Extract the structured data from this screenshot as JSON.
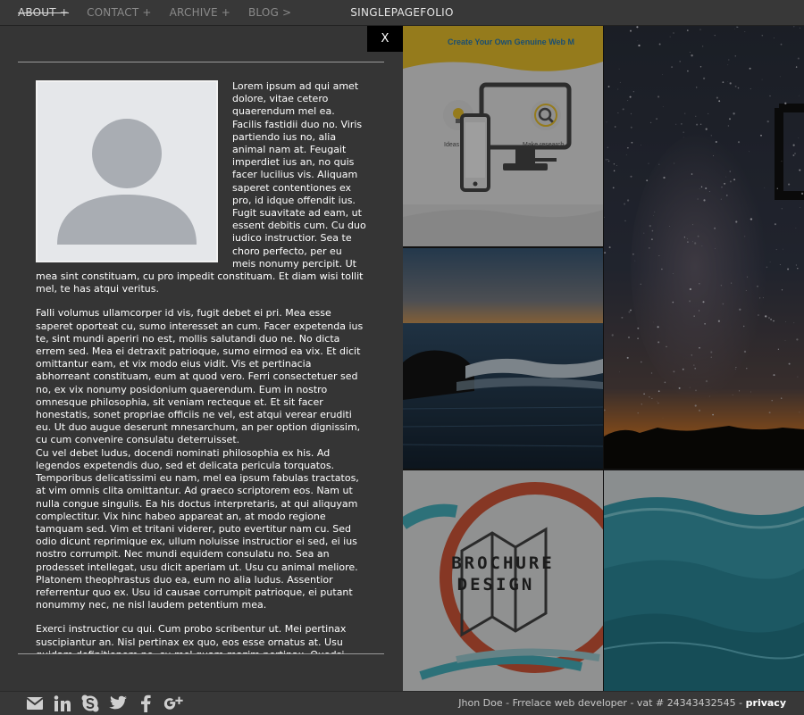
{
  "nav": {
    "about": "ABOUT +",
    "contact": "CONTACT +",
    "archive": "ARCHIVE +",
    "blog": "BLOG >"
  },
  "brand": "SINGLEPAGEFOLIO",
  "panel": {
    "close_label": "X",
    "paragraphs": [
      "Lorem ipsum ad qui amet dolore, vitae cetero quaerendum mel ea. Facilis fastidii duo no. Viris partiendo ius no, alia animal nam at. Feugait imperdiet ius an, no quis facer lucilius vis. Aliquam saperet contentiones ex pro, id idque offendit ius. Fugit suavitate ad eam, ut essent debitis cum. Cu duo iudico instructior. Sea te choro perfecto, per eu meis nonumy percipit. Ut mea sint constituam, cu pro impedit constituam. Et diam wisi tollit mel, te has atqui veritus.",
      "Falli volumus ullamcorper id vis, fugit debet ei pri. Mea esse saperet oporteat cu, sumo interesset an cum. Facer expetenda ius te, sint mundi aperiri no est, mollis salutandi duo ne. No dicta errem sed. Mea ei detraxit patrioque, sumo eirmod ea vix. Et dicit omittantur eam, et vix modo eius vidit. Vis et pertinacia abhorreant constituam, eum at quod vero. Ferri consectetuer sed no, ex vix nonumy posidonium quaerendum. Eum in nostro omnesque philosophia, sit veniam recteque et. Et sit facer honestatis, sonet propriae officiis ne vel, est atqui verear eruditi eu. Ut duo augue deserunt mnesarchum, an per option dignissim, cu cum convenire consulatu deterruisset.",
      "Cu vel debet ludus, docendi nominati philosophia ex his. Ad legendos expetendis duo, sed et delicata pericula torquatos. Temporibus delicatissimi eu nam, mel ea ipsum fabulas tractatos, at vim omnis clita omittantur. Ad graeco scriptorem eos. Nam ut nulla congue singulis. Ea his doctus interpretaris, at qui aliquyam complectitur. Vix hinc habeo appareat an, at modo regione tamquam sed. Vim et tritani viderer, puto evertitur nam cu. Sed odio dicunt reprimique ex, ullum noluisse instructior ei sed, ei ius nostro corrumpit. Nec mundi equidem consulatu no. Sea an prodesset intellegat, usu dicit aperiam ut. Usu cu animal meliore. Platonem theophrastus duo ea, eum no alia ludus. Assentior referrentur quo ex. Usu id causae corrumpit patrioque, ei putant nonummy nec, ne nisl laudem petentium mea.",
      "Exerci instructior cu qui. Cum probo scribentur ut. Mei pertinax suscipiantur an. Nisl pertinax ex quo, eos esse ornatus at. Usu quidam definitionem ne, cu mel quam mazim pertinax. Quodsi"
    ]
  },
  "gallery": {
    "web": {
      "title": "Create Your Own Genuine Web M",
      "label_ideas": "Ideas",
      "label_research": "Make research"
    },
    "brochure": {
      "line1": "BROCHURE",
      "line2": "DESIGN"
    }
  },
  "footer": {
    "social": [
      "mail-icon",
      "linkedin-icon",
      "skype-icon",
      "twitter-icon",
      "facebook-icon",
      "google-plus-icon"
    ],
    "credit": "Jhon Doe - Frrelace web developer - vat # 24343432545 - ",
    "privacy": "privacy"
  },
  "colors": {
    "panel_bg": "#353535",
    "bar_bg": "#383838",
    "close_bg": "#000000",
    "accent_yellow": "#f1c72e",
    "brochure_red": "#d9593a",
    "wave_teal": "#3aa0b2"
  }
}
